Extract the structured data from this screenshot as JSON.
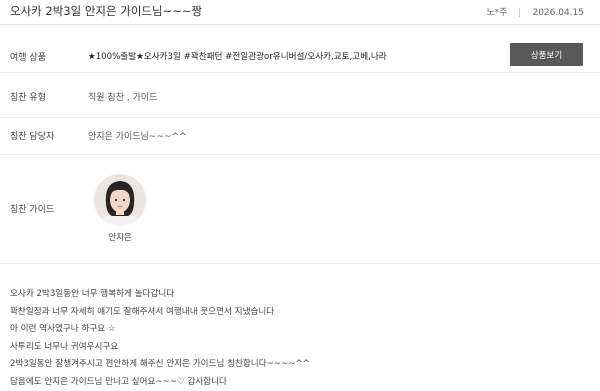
{
  "header": {
    "title": "오사카 2박3일 안지은 가이드님~~~짱",
    "author": "노*주",
    "date": "2026.04.15"
  },
  "fields": {
    "product_label": "여행 상품",
    "product_value": "★100%출발★오사카3일 #꽉찬패턴 #전일관광or유니버설/오사카,교토,고베,나라",
    "product_button": "상품보기",
    "type_label": "칭찬 유형",
    "type_value": "직원 칭찬 , 가이드",
    "staff_label": "칭찬 담당자",
    "staff_value": "안지은 가이드님~~~^^",
    "guide_label": "칭찬 가이드",
    "guide_name": "안지은"
  },
  "body_lines": [
    "오사카 2박3일동안 너무 행복하게 놀다갑니다",
    "꽉찬일정과 너무 자세히 얘기도 잘해주셔서 여행내내 웃으면서 지냈습니다",
    "아 이런 역사였구나 하구요 ☆",
    "사투리도 너무나 귀여우시구요",
    "2박3일동안 잘챙겨주시고 편안하게 해주신 안지은 가이드님 칭찬합니다~~~~^^",
    "담음에도 안지은 가이드님 만나고 싶어요~~~♡ 감사합니다"
  ]
}
